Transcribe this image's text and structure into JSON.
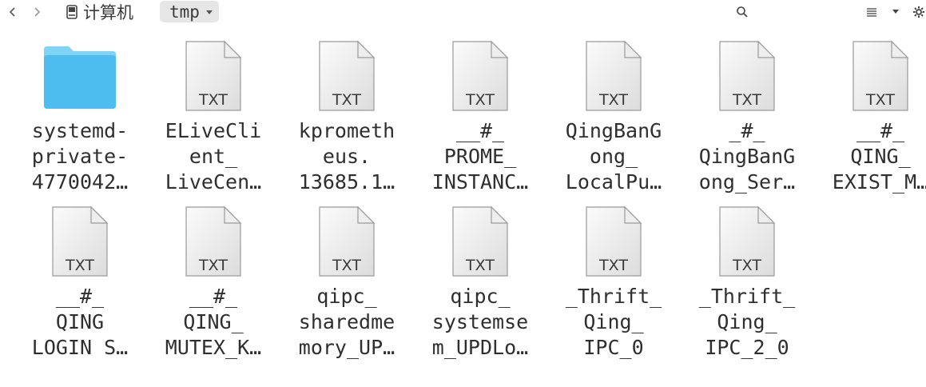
{
  "toolbar": {
    "back_icon": "chevron-left-icon",
    "forward_icon": "chevron-right-icon",
    "breadcrumb_root": "计算机",
    "breadcrumb_current": "tmp",
    "search_icon": "search-icon",
    "view_icon": "list-view-icon",
    "sort_icon": "chevron-down-icon",
    "settings_icon": "gear-icon"
  },
  "colors": {
    "folder": "#4dbdf0",
    "folder_tab": "#7fd3f7",
    "breadcrumb_active_bg": "#e6e6e6"
  },
  "files": [
    {
      "type": "folder",
      "label_lines": [
        "systemd-",
        "private-",
        "4770042…"
      ]
    },
    {
      "type": "txt",
      "badge": "TXT",
      "label_lines": [
        "ELiveCli",
        "ent_",
        "LiveCen…"
      ]
    },
    {
      "type": "txt",
      "badge": "TXT",
      "label_lines": [
        "kprometh",
        "eus.",
        "13685.1…"
      ]
    },
    {
      "type": "txt",
      "badge": "TXT",
      "label_lines": [
        "__#_",
        "PROME_",
        "INSTANC…"
      ]
    },
    {
      "type": "txt",
      "badge": "TXT",
      "label_lines": [
        "QingBanG",
        "ong_",
        "LocalPu…"
      ]
    },
    {
      "type": "txt",
      "badge": "TXT",
      "label_lines": [
        "_#_",
        "QingBanG",
        "ong_Ser…"
      ]
    },
    {
      "type": "txt",
      "badge": "TXT",
      "label_lines": [
        "__#_",
        "QING_",
        "EXIST_M…"
      ]
    },
    {
      "type": "txt",
      "badge": "TXT",
      "label_lines": [
        "__#_",
        "QING",
        "LOGIN S…"
      ]
    },
    {
      "type": "txt",
      "badge": "TXT",
      "label_lines": [
        "__#_",
        "QING_",
        "MUTEX_K…"
      ]
    },
    {
      "type": "txt",
      "badge": "TXT",
      "label_lines": [
        "qipc_",
        "sharedme",
        "mory_UP…"
      ]
    },
    {
      "type": "txt",
      "badge": "TXT",
      "label_lines": [
        "qipc_",
        "systemse",
        "m_UPDLo…"
      ]
    },
    {
      "type": "txt",
      "badge": "TXT",
      "label_lines": [
        "_Thrift_",
        "Qing_",
        "IPC_0"
      ]
    },
    {
      "type": "txt",
      "badge": "TXT",
      "label_lines": [
        "_Thrift_",
        "Qing_",
        "IPC_2_0"
      ]
    }
  ]
}
